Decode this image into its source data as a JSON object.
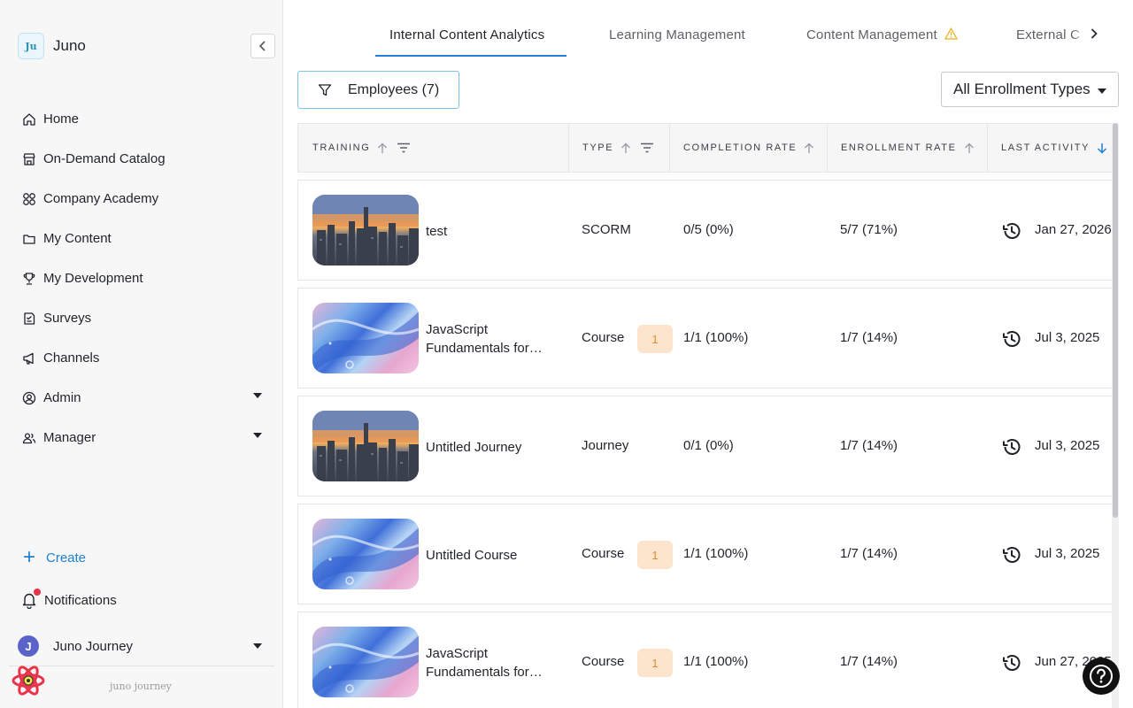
{
  "app": {
    "name": "Juno",
    "logo_text": "Ju"
  },
  "sidebar": {
    "items": [
      {
        "label": "Home",
        "icon": "home-icon"
      },
      {
        "label": "On-Demand Catalog",
        "icon": "store-icon"
      },
      {
        "label": "Company Academy",
        "icon": "grid-icon"
      },
      {
        "label": "My Content",
        "icon": "folder-icon"
      },
      {
        "label": "My Development",
        "icon": "trophy-icon"
      },
      {
        "label": "Surveys",
        "icon": "survey-icon"
      },
      {
        "label": "Channels",
        "icon": "megaphone-icon"
      },
      {
        "label": "Admin",
        "icon": "user-circle-icon",
        "expandable": true
      },
      {
        "label": "Manager",
        "icon": "users-icon",
        "expandable": true
      }
    ],
    "create_label": "Create",
    "notifications_label": "Notifications",
    "user": {
      "initial": "J",
      "name": "Juno Journey"
    },
    "footer_brand": "juno journey"
  },
  "tabs": [
    {
      "label": "Internal Content Analytics",
      "active": true
    },
    {
      "label": "Learning Management",
      "active": false
    },
    {
      "label": "Content Management",
      "active": false,
      "warning": true
    },
    {
      "label": "External C",
      "active": false
    }
  ],
  "toolbar": {
    "filter_label": "Employees (7)",
    "enrollment_select": "All Enrollment Types"
  },
  "table": {
    "columns": [
      {
        "label": "Training",
        "sortable": true,
        "filterable": true
      },
      {
        "label": "Type",
        "sortable": true,
        "filterable": true
      },
      {
        "label": "Completion Rate",
        "sortable": true
      },
      {
        "label": "Enrollment Rate",
        "sortable": true
      },
      {
        "label": "Last Activity",
        "sortable": true,
        "sorted": "desc"
      }
    ],
    "rows": [
      {
        "thumb": "city",
        "title": "test",
        "type": "SCORM",
        "badge": "",
        "completion": "0/5 (0%)",
        "enrollment": "5/7 (71%)",
        "last_activity": "Jan 27, 2026"
      },
      {
        "thumb": "abstract",
        "title": "JavaScript Fundamentals for…",
        "type": "Course",
        "badge": "1",
        "completion": "1/1 (100%)",
        "enrollment": "1/7 (14%)",
        "last_activity": "Jul 3, 2025"
      },
      {
        "thumb": "city",
        "title": "Untitled Journey",
        "type": "Journey",
        "badge": "",
        "completion": "0/1 (0%)",
        "enrollment": "1/7 (14%)",
        "last_activity": "Jul 3, 2025"
      },
      {
        "thumb": "abstract",
        "title": "Untitled Course",
        "type": "Course",
        "badge": "1",
        "completion": "1/1 (100%)",
        "enrollment": "1/7 (14%)",
        "last_activity": "Jul 3, 2025"
      },
      {
        "thumb": "abstract",
        "title": "JavaScript Fundamentals for…",
        "type": "Course",
        "badge": "1",
        "completion": "1/1 (100%)",
        "enrollment": "1/7 (14%)",
        "last_activity": "Jun 27, 2025"
      }
    ]
  },
  "colors": {
    "accent": "#1d7fd6",
    "badge_bg": "#fde5cd",
    "badge_text": "#e08a32",
    "notification_dot": "#e8334a",
    "avatar": "#5a63c9"
  }
}
